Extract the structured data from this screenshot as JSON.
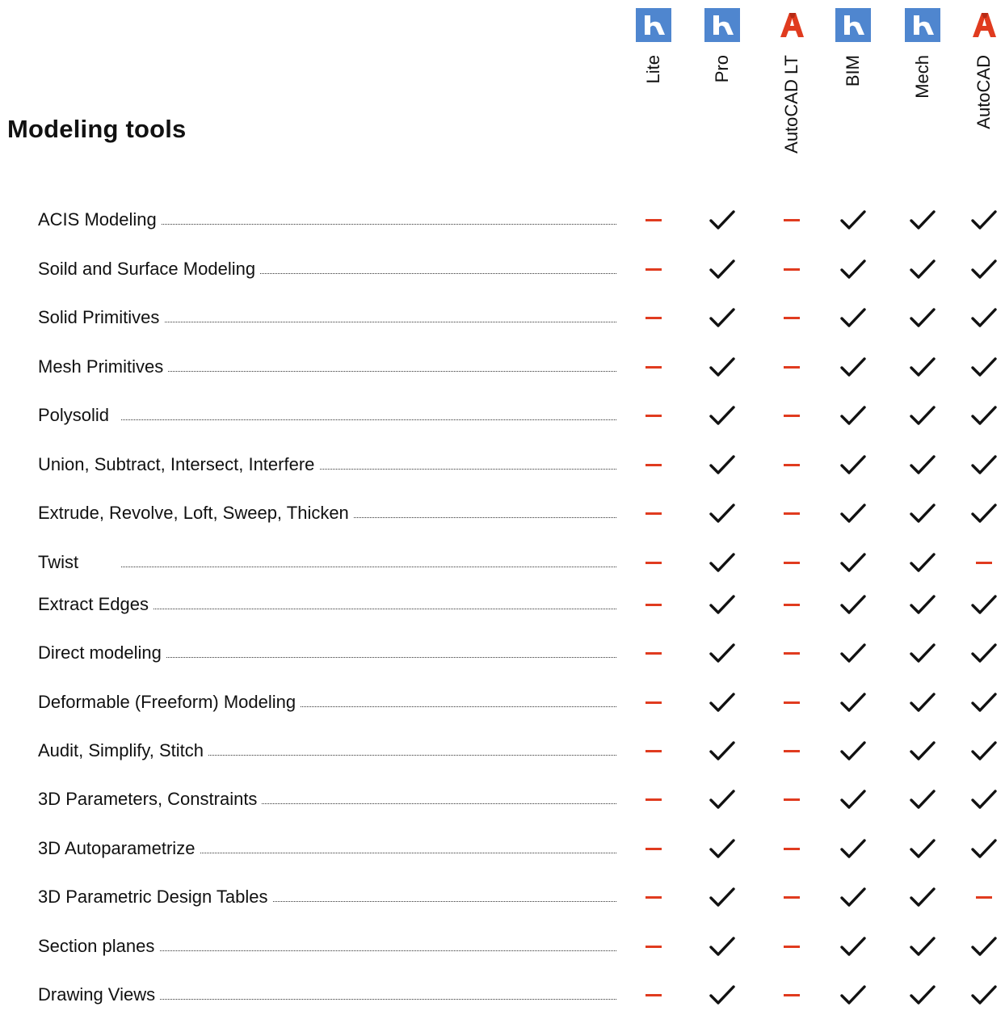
{
  "title": "Modeling tools",
  "colors": {
    "bricscad_blue": "#4f86cf",
    "autocad_red": "#e03b1f",
    "check": "#111111",
    "dash": "#e03b1f"
  },
  "columns": [
    {
      "label": "Lite",
      "logo": "bricscad-logo-icon"
    },
    {
      "label": "Pro",
      "logo": "bricscad-logo-icon"
    },
    {
      "label": "AutoCAD LT",
      "logo": "autocad-logo-icon"
    },
    {
      "label": "BIM",
      "logo": "bricscad-logo-icon"
    },
    {
      "label": "Mech",
      "logo": "bricscad-logo-icon"
    },
    {
      "label": "AutoCAD",
      "logo": "autocad-logo-icon"
    }
  ],
  "features": [
    {
      "name": "ACIS Modeling",
      "support": [
        false,
        true,
        false,
        true,
        true,
        true
      ]
    },
    {
      "name": "Soild and Surface Modeling",
      "support": [
        false,
        true,
        false,
        true,
        true,
        true
      ]
    },
    {
      "name": "Solid Primitives",
      "support": [
        false,
        true,
        false,
        true,
        true,
        true
      ]
    },
    {
      "name": "Mesh Primitives",
      "support": [
        false,
        true,
        false,
        true,
        true,
        true
      ]
    },
    {
      "name": "Polysolid",
      "support": [
        false,
        true,
        false,
        true,
        true,
        true
      ]
    },
    {
      "name": "Union, Subtract, Intersect, Interfere",
      "support": [
        false,
        true,
        false,
        true,
        true,
        true
      ]
    },
    {
      "name": "Extrude, Revolve, Loft, Sweep, Thicken",
      "support": [
        false,
        true,
        false,
        true,
        true,
        true
      ]
    },
    {
      "name": "Twist",
      "support": [
        false,
        true,
        false,
        true,
        true,
        false
      ]
    },
    {
      "name": "Extract Edges",
      "support": [
        false,
        true,
        false,
        true,
        true,
        true
      ]
    },
    {
      "name": "Direct modeling",
      "support": [
        false,
        true,
        false,
        true,
        true,
        true
      ]
    },
    {
      "name": "Deformable (Freeform) Modeling",
      "support": [
        false,
        true,
        false,
        true,
        true,
        true
      ]
    },
    {
      "name": "Audit, Simplify, Stitch",
      "support": [
        false,
        true,
        false,
        true,
        true,
        true
      ]
    },
    {
      "name": "3D Parameters, Constraints",
      "support": [
        false,
        true,
        false,
        true,
        true,
        true
      ]
    },
    {
      "name": "3D Autoparametrize",
      "support": [
        false,
        true,
        false,
        true,
        true,
        true
      ]
    },
    {
      "name": "3D Parametric Design Tables",
      "support": [
        false,
        true,
        false,
        true,
        true,
        false
      ]
    },
    {
      "name": "Section planes",
      "support": [
        false,
        true,
        false,
        true,
        true,
        true
      ]
    },
    {
      "name": "Drawing Views",
      "support": [
        false,
        true,
        false,
        true,
        true,
        true
      ]
    }
  ]
}
